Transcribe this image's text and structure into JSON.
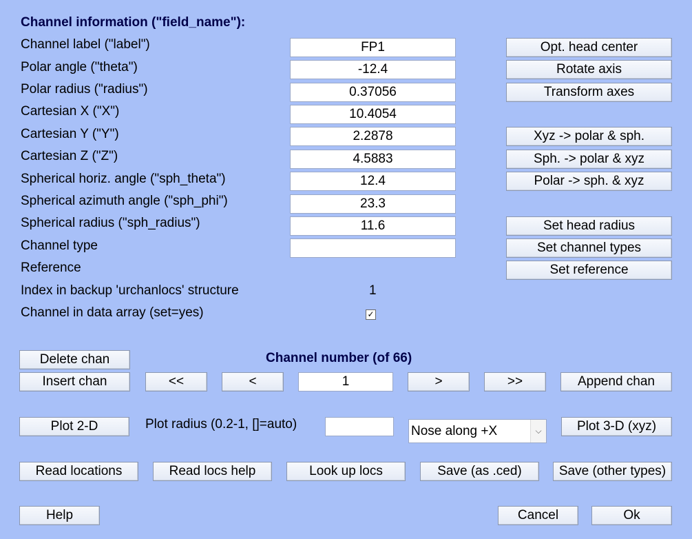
{
  "header": "Channel information (\"field_name\"):",
  "fields": [
    {
      "label": "Channel label (\"label\")",
      "value": "FP1"
    },
    {
      "label": "Polar angle (\"theta\")",
      "value": "-12.4"
    },
    {
      "label": "Polar radius (\"radius\")",
      "value": "0.37056"
    },
    {
      "label": "Cartesian X (\"X\")",
      "value": "10.4054"
    },
    {
      "label": "Cartesian Y (\"Y\")",
      "value": "2.2878"
    },
    {
      "label": "Cartesian Z (\"Z\")",
      "value": "4.5883"
    },
    {
      "label": "Spherical horiz. angle (\"sph_theta\")",
      "value": "12.4"
    },
    {
      "label": "Spherical azimuth angle (\"sph_phi\")",
      "value": "23.3"
    },
    {
      "label": "Spherical radius (\"sph_radius\")",
      "value": "11.6"
    },
    {
      "label": "Channel type",
      "value": ""
    }
  ],
  "reference_label": "Reference",
  "index_label": "Index in backup 'urchanlocs' structure",
  "index_value": "1",
  "in_data_label": "Channel in data array (set=yes)",
  "in_data_checked": true,
  "right_buttons": {
    "opt_head_center": "Opt. head center",
    "rotate_axis": "Rotate axis",
    "transform_axes": "Transform axes",
    "xyz_polar_sph": "Xyz -> polar & sph.",
    "sph_polar_xyz": "Sph. -> polar & xyz",
    "polar_sph_xyz": "Polar -> sph. & xyz",
    "set_head_radius": "Set head radius",
    "set_channel_types": "Set channel types",
    "set_reference": "Set reference"
  },
  "nav": {
    "title": "Channel number (of 66)",
    "delete": "Delete chan",
    "insert": "Insert chan",
    "first": "<<",
    "prev": "<",
    "current": "1",
    "next": ">",
    "last": ">>",
    "append": "Append chan"
  },
  "plot": {
    "plot2d": "Plot 2-D",
    "radius_label": "Plot radius (0.2-1, []=auto)",
    "radius_value": "",
    "nose_selected": "Nose along +X",
    "plot3d": "Plot 3-D (xyz)"
  },
  "bottom": {
    "read_locations": "Read locations",
    "read_locs_help": "Read locs help",
    "look_up_locs": "Look up locs",
    "save_ced": "Save (as .ced)",
    "save_other": "Save (other types)",
    "help": "Help",
    "cancel": "Cancel",
    "ok": "Ok"
  },
  "icons": {
    "check": "checkmark-icon",
    "dropdown": "chevron-down-icon"
  }
}
